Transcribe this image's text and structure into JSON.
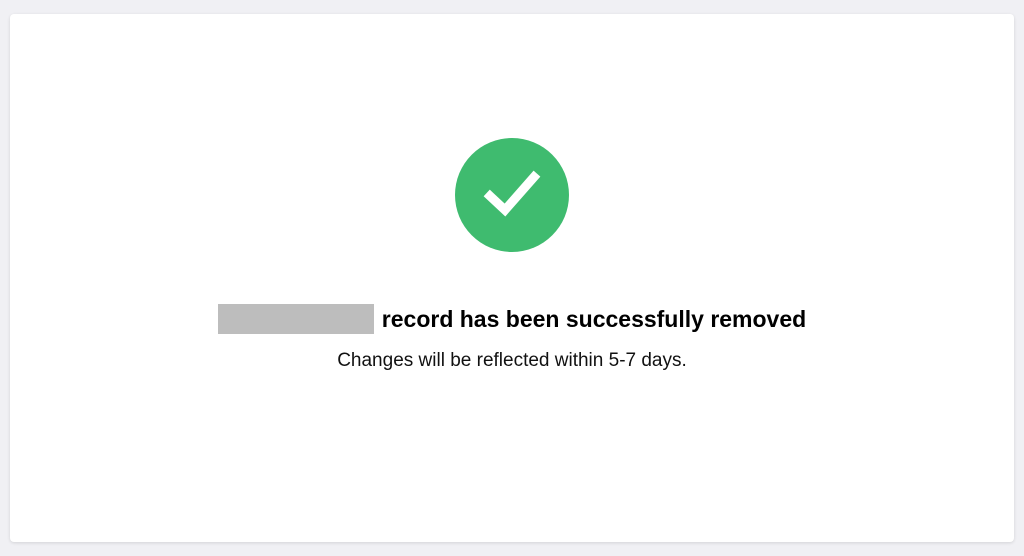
{
  "colors": {
    "page_background": "#f0f0f4",
    "card_background": "#ffffff",
    "success_green": "#3fbb6f",
    "check_mark": "#ffffff",
    "redaction": "#bdbdbd"
  },
  "icon": "check-circle-icon",
  "message": {
    "title": "record has been successfully removed",
    "detail": "Changes will be reflected within 5-7 days."
  }
}
